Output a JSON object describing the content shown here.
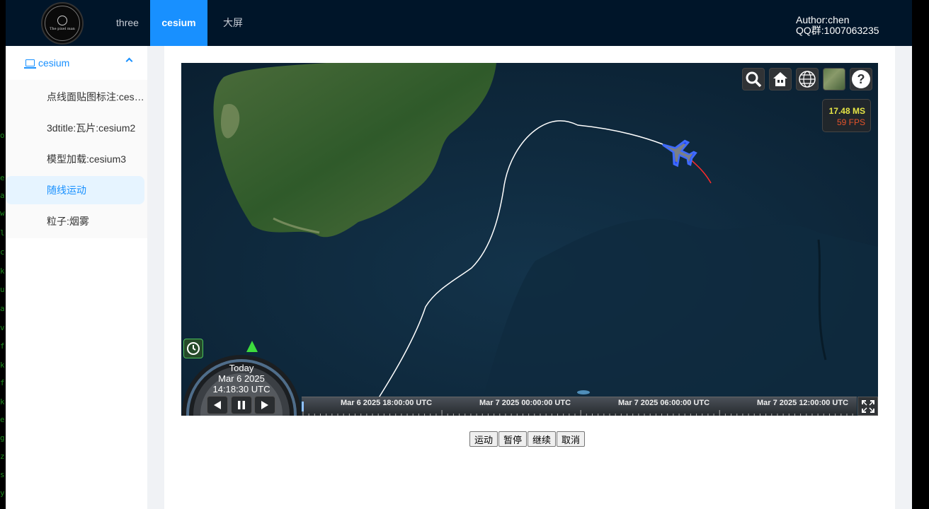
{
  "header": {
    "logo_text": "The pixel man",
    "nav": [
      {
        "label": "three",
        "active": false
      },
      {
        "label": "cesium",
        "active": true
      },
      {
        "label": "大屏",
        "active": false
      }
    ],
    "author_line1": "Author:chen",
    "author_line2": "QQ群:1007063235"
  },
  "sidebar": {
    "group_label": "cesium",
    "items": [
      {
        "label": "点线面贴图标注:cesium1",
        "active": false
      },
      {
        "label": "3dtitle:瓦片:cesium2",
        "active": false
      },
      {
        "label": "模型加载:cesium3",
        "active": false
      },
      {
        "label": "随线运动",
        "active": true
      },
      {
        "label": "粒子:烟雾",
        "active": false
      }
    ]
  },
  "matrix_chars": [
    "o",
    "e",
    "a",
    "w",
    "l",
    "c",
    "k",
    "u",
    "a",
    "v",
    "f",
    "k",
    "f",
    "k",
    "e",
    "g",
    "z",
    "s",
    "y"
  ],
  "viewer": {
    "toolbar_icons": [
      "search-icon",
      "home-icon",
      "globe-icon",
      "basemap-picker-icon",
      "help-icon"
    ],
    "fps_ms": "17.48 MS",
    "fps_fps": "59 FPS",
    "clock": {
      "day": "Today",
      "date": "Mar 6 2025",
      "time": "14:18:30 UTC"
    },
    "timeline_labels": [
      "Mar 6 2025 18:00:00 UTC",
      "Mar 7 2025 00:00:00 UTC",
      "Mar 7 2025 06:00:00 UTC",
      "Mar 7 2025 12:00:00 UTC"
    ]
  },
  "controls": {
    "start": "运动",
    "pause": "暂停",
    "resume": "继续",
    "cancel": "取消"
  }
}
